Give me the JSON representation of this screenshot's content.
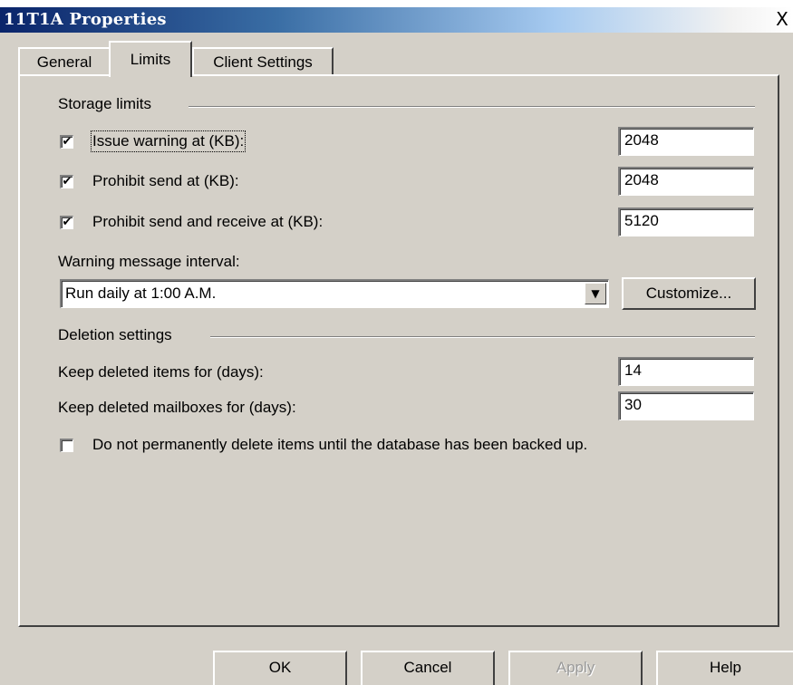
{
  "window": {
    "title": "11T1A Properties",
    "close_glyph": "X"
  },
  "tabs": [
    {
      "label": "General"
    },
    {
      "label": "Limits"
    },
    {
      "label": "Client Settings"
    }
  ],
  "storage_limits": {
    "heading": "Storage limits",
    "issue_warning": {
      "label": "Issue warning at (KB):",
      "checked": true,
      "value": "2048"
    },
    "prohibit_send": {
      "label": "Prohibit send at (KB):",
      "checked": true,
      "value": "2048"
    },
    "prohibit_send_receive": {
      "label": "Prohibit send and receive at (KB):",
      "checked": true,
      "value": "5120"
    },
    "warning_interval_label": "Warning message interval:",
    "warning_interval_value": "Run daily at 1:00 A.M.",
    "customize_label": "Customize..."
  },
  "deletion_settings": {
    "heading": "Deletion settings",
    "keep_items_label": "Keep deleted items for (days):",
    "keep_items_value": "14",
    "keep_mailboxes_label": "Keep deleted mailboxes for (days):",
    "keep_mailboxes_value": "30",
    "no_delete_until_backup": {
      "label": "Do not permanently delete items until the database has been backed up.",
      "checked": false
    }
  },
  "footer": {
    "ok_label": "OK",
    "cancel_label": "Cancel",
    "apply_label": "Apply",
    "help_label": "Help"
  },
  "glyphs": {
    "check": "✔",
    "dropdown_arrow": "▼"
  },
  "colors": {
    "dialog_face": "#d4d0c8",
    "titlebar_start": "#0a246a",
    "titlebar_end": "#ffffff"
  }
}
